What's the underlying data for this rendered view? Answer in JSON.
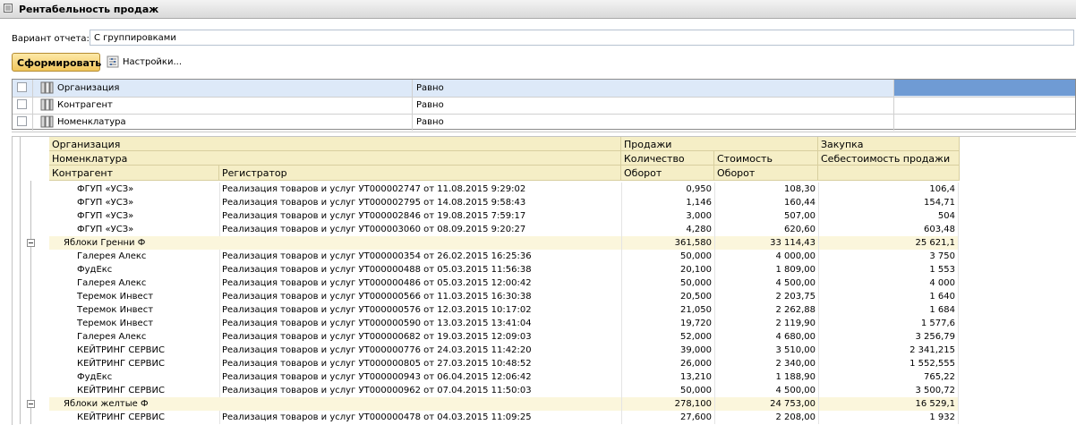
{
  "window": {
    "title": "Рентабельность продаж"
  },
  "variant": {
    "label": "Вариант отчета:",
    "value": "С группировками"
  },
  "toolbar": {
    "generate_label": "Сформировать",
    "settings_label": "Настройки..."
  },
  "filters": [
    {
      "name": "Организация",
      "condition": "Равно",
      "selected": true
    },
    {
      "name": "Контрагент",
      "condition": "Равно",
      "selected": false
    },
    {
      "name": "Номенклатура",
      "condition": "Равно",
      "selected": false
    }
  ],
  "report": {
    "headers": {
      "organization": "Организация",
      "nomenclature": "Номенклатура",
      "counterparty": "Контрагент",
      "registrar": "Регистратор",
      "sales": "Продажи",
      "quantity": "Количество",
      "turnover1": "Оборот",
      "cost": "Стоимость",
      "turnover2": "Оборот",
      "purchase": "Закупка",
      "cost_of_sales": "Себестоимость продажи"
    },
    "rows": [
      {
        "type": "detail",
        "counterparty": "ФГУП «УСЗ»",
        "registrar": "Реализация товаров и услуг УТ000002747 от 11.08.2015 9:29:02",
        "qty": "0,950",
        "cost": "108,30",
        "cogs": "106,4"
      },
      {
        "type": "detail",
        "counterparty": "ФГУП «УСЗ»",
        "registrar": "Реализация товаров и услуг УТ000002795 от 14.08.2015 9:58:43",
        "qty": "1,146",
        "cost": "160,44",
        "cogs": "154,71"
      },
      {
        "type": "detail",
        "counterparty": "ФГУП «УСЗ»",
        "registrar": "Реализация товаров и услуг УТ000002846 от 19.08.2015 7:59:17",
        "qty": "3,000",
        "cost": "507,00",
        "cogs": "504"
      },
      {
        "type": "detail",
        "counterparty": "ФГУП «УСЗ»",
        "registrar": "Реализация товаров и услуг УТ000003060 от 08.09.2015 9:20:27",
        "qty": "4,280",
        "cost": "620,60",
        "cogs": "603,48"
      },
      {
        "type": "group",
        "name": "Яблоки Гренни Ф",
        "qty": "361,580",
        "cost": "33 114,43",
        "cogs": "25 621,1"
      },
      {
        "type": "detail",
        "counterparty": "Галерея Алекс",
        "registrar": "Реализация товаров и услуг УТ000000354 от 26.02.2015 16:25:36",
        "qty": "50,000",
        "cost": "4 000,00",
        "cogs": "3 750"
      },
      {
        "type": "detail",
        "counterparty": "ФудЕкс",
        "registrar": "Реализация товаров и услуг УТ000000488 от 05.03.2015 11:56:38",
        "qty": "20,100",
        "cost": "1 809,00",
        "cogs": "1 553"
      },
      {
        "type": "detail",
        "counterparty": "Галерея Алекс",
        "registrar": "Реализация товаров и услуг УТ000000486 от 05.03.2015 12:00:42",
        "qty": "50,000",
        "cost": "4 500,00",
        "cogs": "4 000"
      },
      {
        "type": "detail",
        "counterparty": "Теремок Инвест",
        "registrar": "Реализация товаров и услуг УТ000000566 от 11.03.2015 16:30:38",
        "qty": "20,500",
        "cost": "2 203,75",
        "cogs": "1 640"
      },
      {
        "type": "detail",
        "counterparty": "Теремок Инвест",
        "registrar": "Реализация товаров и услуг УТ000000576 от 12.03.2015 10:17:02",
        "qty": "21,050",
        "cost": "2 262,88",
        "cogs": "1 684"
      },
      {
        "type": "detail",
        "counterparty": "Теремок Инвест",
        "registrar": "Реализация товаров и услуг УТ000000590 от 13.03.2015 13:41:04",
        "qty": "19,720",
        "cost": "2 119,90",
        "cogs": "1 577,6"
      },
      {
        "type": "detail",
        "counterparty": "Галерея Алекс",
        "registrar": "Реализация товаров и услуг УТ000000682 от 19.03.2015 12:09:03",
        "qty": "52,000",
        "cost": "4 680,00",
        "cogs": "3 256,79"
      },
      {
        "type": "detail",
        "counterparty": "КЕЙТРИНГ СЕРВИС",
        "registrar": "Реализация товаров и услуг УТ000000776 от 24.03.2015 11:42:20",
        "qty": "39,000",
        "cost": "3 510,00",
        "cogs": "2 341,215"
      },
      {
        "type": "detail",
        "counterparty": "КЕЙТРИНГ СЕРВИС",
        "registrar": "Реализация товаров и услуг УТ000000805 от 27.03.2015 10:48:52",
        "qty": "26,000",
        "cost": "2 340,00",
        "cogs": "1 552,555"
      },
      {
        "type": "detail",
        "counterparty": "ФудЕкс",
        "registrar": "Реализация товаров и услуг УТ000000943 от 06.04.2015 12:06:42",
        "qty": "13,210",
        "cost": "1 188,90",
        "cogs": "765,22"
      },
      {
        "type": "detail",
        "counterparty": "КЕЙТРИНГ СЕРВИС",
        "registrar": "Реализация товаров и услуг УТ000000962 от 07.04.2015 11:50:03",
        "qty": "50,000",
        "cost": "4 500,00",
        "cogs": "3 500,72"
      },
      {
        "type": "group",
        "name": "Яблоки желтые Ф",
        "qty": "278,100",
        "cost": "24 753,00",
        "cogs": "16 529,1"
      },
      {
        "type": "detail",
        "counterparty": "КЕЙТРИНГ СЕРВИС",
        "registrar": "Реализация товаров и услуг УТ000000478 от 04.03.2015 11:09:25",
        "qty": "27,600",
        "cost": "2 208,00",
        "cogs": "1 932"
      }
    ]
  }
}
